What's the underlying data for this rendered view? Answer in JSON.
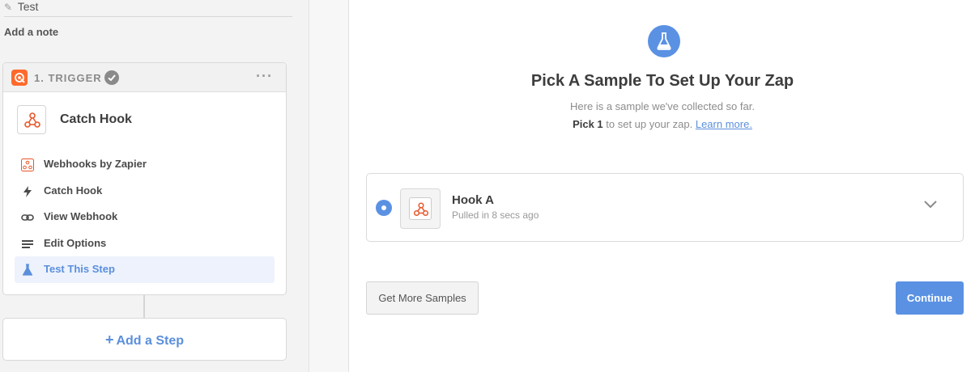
{
  "zap": {
    "name": "Test",
    "add_note": "Add a note"
  },
  "trigger": {
    "header": "1. TRIGGER",
    "app_name": "Catch Hook",
    "steps": [
      {
        "label": "Webhooks by Zapier",
        "icon": "webhook-icon"
      },
      {
        "label": "Catch Hook",
        "icon": "bolt-icon"
      },
      {
        "label": "View Webhook",
        "icon": "link-icon"
      },
      {
        "label": "Edit Options",
        "icon": "list-icon"
      },
      {
        "label": "Test This Step",
        "icon": "flask-icon",
        "active": true
      }
    ]
  },
  "add_step": {
    "label": "Add a Step"
  },
  "main": {
    "title": "Pick A Sample To Set Up Your Zap",
    "subtitle": "Here is a sample we've collected so far.",
    "pick_strong": "Pick 1",
    "pick_text": " to set up your zap. ",
    "learn_more": "Learn more.",
    "sample": {
      "name": "Hook A",
      "meta": "Pulled in 8 secs ago",
      "selected": true
    },
    "buttons": {
      "more": "Get More Samples",
      "continue": "Continue"
    }
  },
  "colors": {
    "accent": "#5a91e3",
    "brand": "#ff6a2c"
  }
}
